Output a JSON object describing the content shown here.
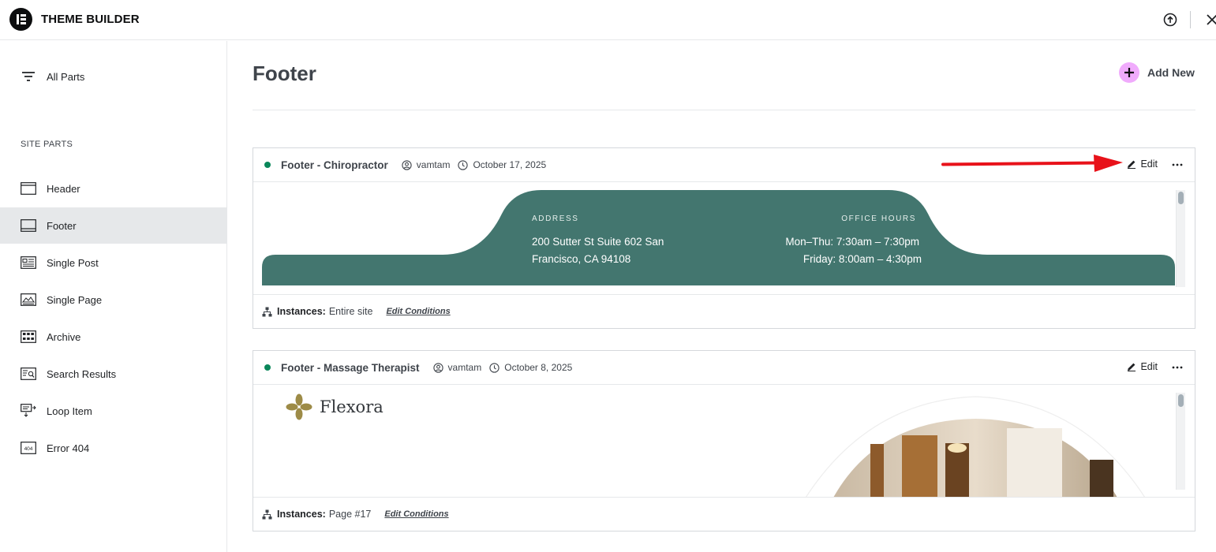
{
  "topbar": {
    "title": "THEME BUILDER"
  },
  "sidebar": {
    "all_parts": "All Parts",
    "section_heading": "SITE PARTS",
    "items": [
      {
        "label": "Header",
        "icon": "header-layout-icon"
      },
      {
        "label": "Footer",
        "icon": "footer-layout-icon"
      },
      {
        "label": "Single Post",
        "icon": "single-post-icon"
      },
      {
        "label": "Single Page",
        "icon": "single-page-icon"
      },
      {
        "label": "Archive",
        "icon": "archive-grid-icon"
      },
      {
        "label": "Search Results",
        "icon": "search-results-icon"
      },
      {
        "label": "Loop Item",
        "icon": "loop-item-icon"
      },
      {
        "label": "Error 404",
        "icon": "error-404-icon"
      }
    ],
    "active": "Footer"
  },
  "main": {
    "title": "Footer",
    "add_new": "Add New",
    "cards": [
      {
        "title": "Footer - Chiropractor",
        "author": "vamtam",
        "date": "October 17, 2025",
        "edit": "Edit",
        "instances_label": "Instances:",
        "instances_value": "Entire site",
        "edit_conditions": "Edit Conditions",
        "preview": {
          "address_label": "ADDRESS",
          "address_line1": "200 Sutter St Suite 602 San",
          "address_line2": "Francisco, CA 94108",
          "hours_label": "OFFICE HOURS",
          "hours_line1": "Mon–Thu: 7:30am – 7:30pm",
          "hours_line2": "Friday: 8:00am – 4:30pm",
          "bg_color": "#43766f"
        }
      },
      {
        "title": "Footer - Massage Therapist",
        "author": "vamtam",
        "date": "October 8, 2025",
        "edit": "Edit",
        "instances_label": "Instances:",
        "instances_value": "Page #17",
        "edit_conditions": "Edit Conditions",
        "preview": {
          "brand": "Flexora",
          "brand_color": "#9d8b47"
        }
      }
    ]
  },
  "colors": {
    "status_published": "#0a875a",
    "add_new_circle": "#f0abfc",
    "annotation_arrow": "#e8121a"
  }
}
